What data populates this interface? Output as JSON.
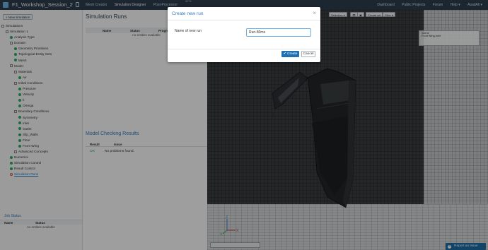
{
  "header": {
    "project_title": "F1_Workshop_Session_2",
    "tabs": [
      "Mesh Creator",
      "Simulation Designer",
      "Post-Processor"
    ],
    "beta_badge": "BETA",
    "links": [
      "Dashboard",
      "Public Projects",
      "Forum",
      "Help ▾",
      "AsadAli ▾"
    ]
  },
  "sidebar": {
    "new_simulation": "+ New simulation",
    "tree": [
      {
        "label": "Simulations",
        "indent": 0,
        "icon": "box"
      },
      {
        "label": "Simulation 1",
        "indent": 1,
        "icon": "box"
      },
      {
        "label": "Analysis Type",
        "indent": 2,
        "icon": "check"
      },
      {
        "label": "Domain",
        "indent": 2,
        "icon": "box"
      },
      {
        "label": "Geometry Primitives",
        "indent": 3,
        "icon": "check"
      },
      {
        "label": "Topological Entity Sets",
        "indent": 3,
        "icon": "check"
      },
      {
        "label": "Mesh",
        "indent": 3,
        "icon": "check"
      },
      {
        "label": "Model",
        "indent": 2,
        "icon": "box"
      },
      {
        "label": "Materials",
        "indent": 3,
        "icon": "box"
      },
      {
        "label": "Air",
        "indent": 4,
        "icon": "check"
      },
      {
        "label": "Initial Conditions",
        "indent": 3,
        "icon": "box"
      },
      {
        "label": "Pressure",
        "indent": 4,
        "icon": "check"
      },
      {
        "label": "Velocity",
        "indent": 4,
        "icon": "check"
      },
      {
        "label": "k",
        "indent": 4,
        "icon": "check"
      },
      {
        "label": "Omega",
        "indent": 4,
        "icon": "check"
      },
      {
        "label": "Boundary Conditions",
        "indent": 3,
        "icon": "box"
      },
      {
        "label": "Symmetry",
        "indent": 4,
        "icon": "check"
      },
      {
        "label": "Inlet",
        "indent": 4,
        "icon": "check"
      },
      {
        "label": "Outlet",
        "indent": 4,
        "icon": "check"
      },
      {
        "label": "Slip_Walls",
        "indent": 4,
        "icon": "check"
      },
      {
        "label": "Floor",
        "indent": 4,
        "icon": "check"
      },
      {
        "label": "Front Wing",
        "indent": 4,
        "icon": "check"
      },
      {
        "label": "Advanced Concepts",
        "indent": 3,
        "icon": "box"
      },
      {
        "label": "Numerics",
        "indent": 2,
        "icon": "check"
      },
      {
        "label": "Simulation Control",
        "indent": 2,
        "icon": "check"
      },
      {
        "label": "Result Control",
        "indent": 2,
        "icon": "check"
      },
      {
        "label": "Simulation Runs",
        "indent": 2,
        "icon": "empty",
        "link": true
      }
    ],
    "jobs": {
      "title": "Job Status",
      "columns": [
        "Name",
        "Status"
      ],
      "empty_text": "no entities available"
    }
  },
  "runs_panel": {
    "title": "Simulation Runs",
    "columns": [
      "Name",
      "Status",
      "Progress"
    ],
    "empty_text": "no entities available"
  },
  "model_check": {
    "title": "Model Checking Results",
    "columns": [
      "Result",
      "Issue"
    ],
    "rows": [
      {
        "result": "OK",
        "issue": "No problems found."
      }
    ]
  },
  "viewer": {
    "toolbar": [
      "Selection ▾",
      "👁",
      "▣",
      "Create set",
      "Filter ▾"
    ],
    "scene_tree": [
      "Scene",
      "Front Wing-Inlet"
    ],
    "report_issue": "Report an issue",
    "report_icon": "?",
    "axes": {
      "x": "X",
      "y": "Y",
      "z": "Z"
    }
  },
  "modal": {
    "title": "Create new run",
    "close": "×",
    "field_label": "Name of new run",
    "field_value": "Run-80ms",
    "create_label": "✔ Create",
    "cancel_label": "Cancel"
  },
  "colors": {
    "accent": "#2d7cc1",
    "topbar": "#2c3e50",
    "ok": "#27ae60",
    "create_button": "#1f6fb2"
  }
}
